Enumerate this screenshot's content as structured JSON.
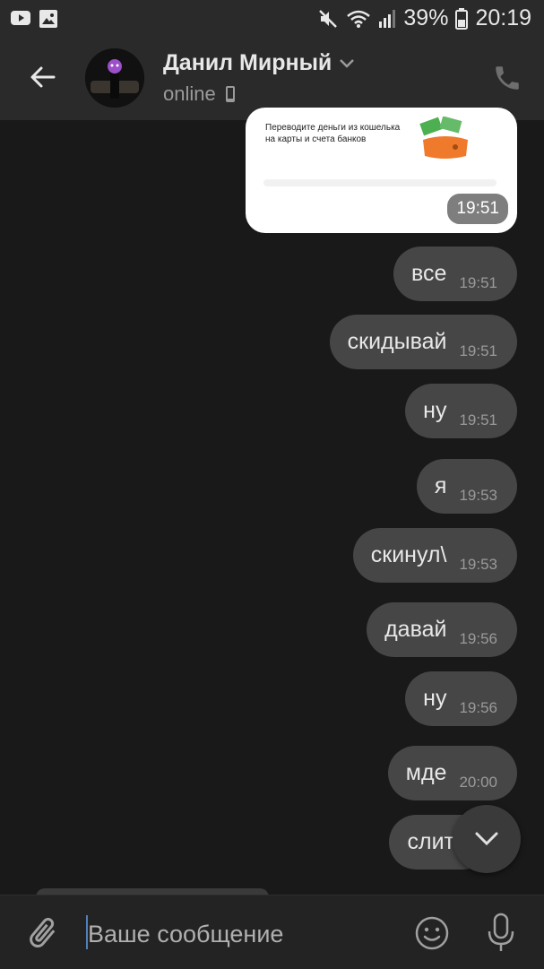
{
  "status_bar": {
    "battery": "39%",
    "time": "20:19",
    "icons": [
      "youtube-icon",
      "image-icon",
      "mute-icon",
      "wifi-icon",
      "signal-icon",
      "battery-icon"
    ]
  },
  "header": {
    "contact_name": "Данил Мирный",
    "status": "online",
    "icons": [
      "back-arrow-icon",
      "chevron-down-icon",
      "mobile-icon",
      "phone-icon"
    ]
  },
  "image_message": {
    "caption_line1": "Переводите деньги из кошелька",
    "caption_line2": "на карты и счета банков",
    "time": "19:51"
  },
  "messages": [
    {
      "text": "все",
      "time": "19:51"
    },
    {
      "text": "скидывай",
      "time": "19:51"
    },
    {
      "text": "ну",
      "time": "19:51"
    },
    {
      "text": "я",
      "time": "19:53"
    },
    {
      "text": "скинул\\",
      "time": "19:53"
    },
    {
      "text": "давай",
      "time": "19:56"
    },
    {
      "text": "ну",
      "time": "19:56"
    },
    {
      "text": "мде",
      "time": "20:00"
    },
    {
      "text": "слит",
      "time": ""
    }
  ],
  "composer": {
    "placeholder": "Ваше сообщение",
    "icons": [
      "attach-icon",
      "emoji-icon",
      "microphone-icon"
    ]
  },
  "colors": {
    "background": "#191919",
    "header": "#2a2a2a",
    "bubble": "#464646",
    "accent": "#5181b8"
  }
}
